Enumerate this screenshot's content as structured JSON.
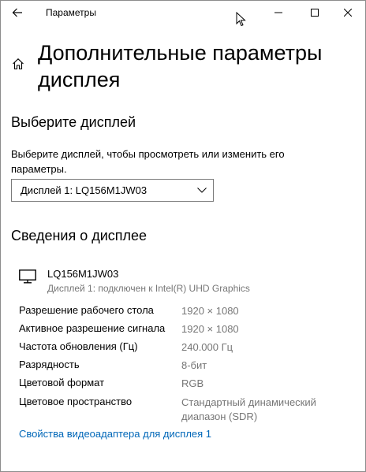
{
  "window": {
    "title": "Параметры",
    "icons": {
      "back": "back-arrow-icon",
      "minimize": "minimize-icon",
      "maximize": "maximize-icon",
      "close": "close-icon"
    }
  },
  "page": {
    "title": "Дополнительные параметры дисплея",
    "home_icon": "home-icon"
  },
  "select_display": {
    "heading": "Выберите дисплей",
    "description": "Выберите дисплей, чтобы просмотреть или изменить его параметры.",
    "selected": "Дисплей 1: LQ156M1JW03"
  },
  "display_info": {
    "heading": "Сведения о дисплее",
    "monitor_name": "LQ156M1JW03",
    "connection": "Дисплей 1: подключен к Intel(R) UHD Graphics",
    "properties": [
      {
        "label": "Разрешение рабочего стола",
        "value": "1920 × 1080"
      },
      {
        "label": "Активное разрешение сигнала",
        "value": "1920 × 1080"
      },
      {
        "label": "Частота обновления (Гц)",
        "value": "240.000 Гц"
      },
      {
        "label": "Разрядность",
        "value": "8-бит"
      },
      {
        "label": "Цветовой формат",
        "value": "RGB"
      },
      {
        "label": "Цветовое пространство",
        "value": "Стандартный динамический диапазон (SDR)"
      }
    ],
    "adapter_link": "Свойства видеоадаптера для дисплея 1"
  },
  "colors": {
    "link": "#0067b8",
    "secondary_text": "#767676",
    "border": "#7a7a7a"
  }
}
